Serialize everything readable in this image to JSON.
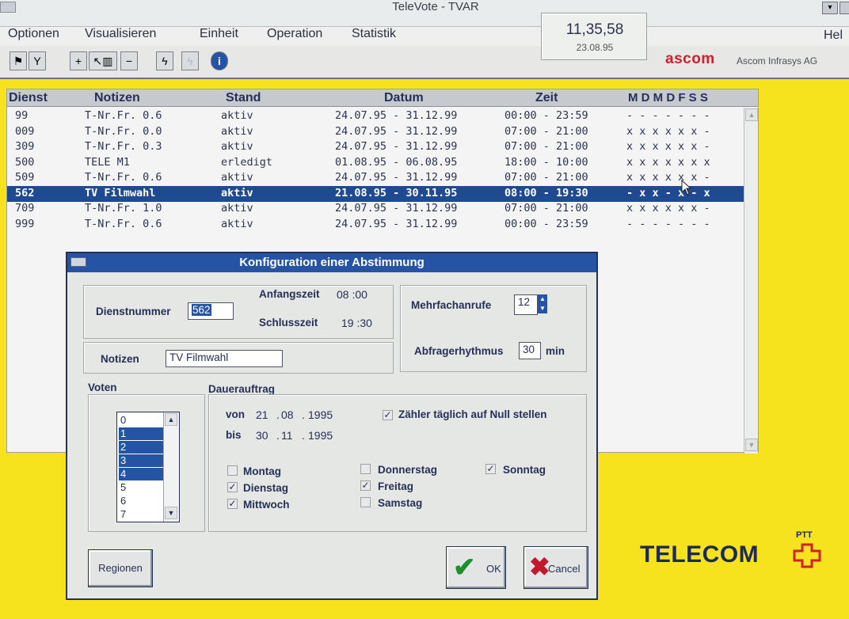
{
  "window": {
    "title": "TeleVote - TVAR",
    "help": "Hel"
  },
  "menu": [
    "Optionen",
    "Visualisieren",
    "Einheit",
    "Operation",
    "Statistik"
  ],
  "clock": {
    "time": "11,35,58",
    "date": "23.08.95"
  },
  "branding": {
    "ascom": "ascom",
    "ascom_sub": "Ascom Infrasys AG",
    "telecom": "TELECOM",
    "ptt": "PTT",
    "colors": {
      "ascom_red": "#d0202c",
      "telecom_blue": "#1d2a58",
      "telecom_cross": "#d0202c",
      "background": "#f7e21e"
    }
  },
  "toolbar": {
    "icons": [
      "flag-icon",
      "tool-icon",
      "add-icon",
      "chart-icon",
      "remove-icon",
      "lightning-icon",
      "lightning-disabled-icon",
      "info-icon"
    ]
  },
  "list": {
    "headers": [
      "Dienst",
      "Notizen",
      "Stand",
      "Datum",
      "Zeit",
      "M D M D F S S"
    ],
    "rows": [
      [
        "99",
        "T-Nr.Fr. 0.6",
        "aktiv",
        "24.07.95 - 31.12.99",
        "00:00 - 23:59",
        "- - - - - - -"
      ],
      [
        "009",
        "T-Nr.Fr. 0.0",
        "aktiv",
        "24.07.95 - 31.12.99",
        "07:00 - 21:00",
        "x x x x x x -"
      ],
      [
        "309",
        "T-Nr.Fr. 0.3",
        "aktiv",
        "24.07.95 - 31.12.99",
        "07:00 - 21:00",
        "x x x x x x -"
      ],
      [
        "500",
        "TELE M1",
        "erledigt",
        "01.08.95 - 06.08.95",
        "18:00 - 10:00",
        "x x x x x x x"
      ],
      [
        "509",
        "T-Nr.Fr. 0.6",
        "aktiv",
        "24.07.95 - 31.12.99",
        "07:00 - 21:00",
        "x x x x x x -"
      ],
      [
        "562",
        "TV Filmwahl",
        "aktiv",
        "21.08.95 - 30.11.95",
        "08:00 - 19:30",
        "- x x - x - x"
      ],
      [
        "709",
        "T-Nr.Fr. 1.0",
        "aktiv",
        "24.07.95 - 31.12.99",
        "07:00 - 21:00",
        "x x x x x x -"
      ],
      [
        "999",
        "T-Nr.Fr. 0.6",
        "aktiv",
        "24.07.95 - 31.12.99",
        "00:00 - 23:59",
        "- - - - - - -"
      ]
    ],
    "selected_index": 5
  },
  "dialog": {
    "title": "Konfiguration einer Abstimmung",
    "dienstnummer_label": "Dienstnummer",
    "dienstnummer": "562",
    "anfangszeit_label": "Anfangszeit",
    "anfangszeit": "08 :00",
    "schlusszeit_label": "Schlusszeit",
    "schlusszeit": "19 :30",
    "mehrfach_label": "Mehrfachanrufe",
    "mehrfach": "12",
    "notizen_label": "Notizen",
    "notizen": "TV Filmwahl",
    "abfrage_label": "Abfragerhythmus",
    "abfrage": "30",
    "abfrage_unit": "min",
    "voten_label": "Voten",
    "voten": [
      "0",
      "1",
      "2",
      "3",
      "4",
      "5",
      "6",
      "7"
    ],
    "voten_selected": [
      1,
      2,
      3,
      4
    ],
    "dauer_label": "Dauerauftrag",
    "von_label": "von",
    "von_day": "21",
    "von_month": "08",
    "von_year": "1995",
    "bis_label": "bis",
    "bis_day": "30",
    "bis_month": "11",
    "bis_year": "1995",
    "zaehler_label": "Zähler täglich auf Null stellen",
    "zaehler_checked": true,
    "days": {
      "montag": {
        "label": "Montag",
        "checked": false
      },
      "dienstag": {
        "label": "Dienstag",
        "checked": true
      },
      "mittwoch": {
        "label": "Mittwoch",
        "checked": true
      },
      "donnerstag": {
        "label": "Donnerstag",
        "checked": false
      },
      "freitag": {
        "label": "Freitag",
        "checked": true
      },
      "samstag": {
        "label": "Samstag",
        "checked": false
      },
      "sonntag": {
        "label": "Sonntag",
        "checked": true
      }
    },
    "regionen_label": "Regionen",
    "ok_label": "OK",
    "cancel_label": "Cancel"
  }
}
